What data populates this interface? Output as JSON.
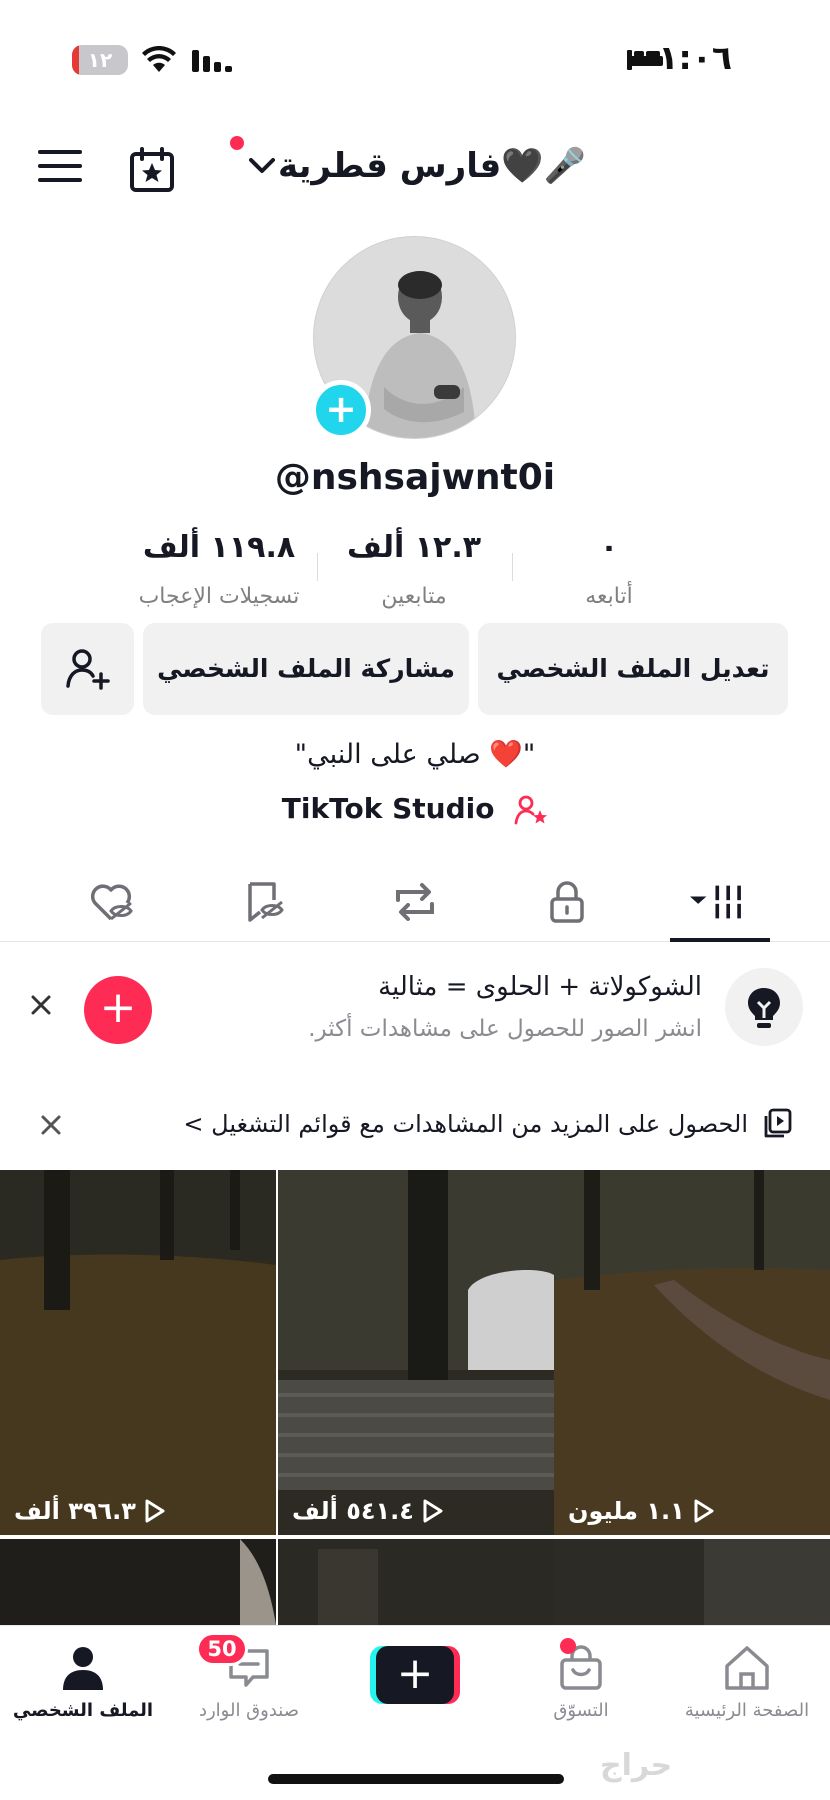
{
  "status_bar": {
    "time": "١:٠٦",
    "battery": "١٢",
    "battery_level": 0.12
  },
  "header": {
    "profile_name": "فارس قطرية🖤🎤"
  },
  "profile": {
    "username": "@nshsajwnt0i",
    "stats": [
      {
        "value": "٠",
        "label": "أتابعه"
      },
      {
        "value": "١٢.٣ ألف",
        "label": "متابعين"
      },
      {
        "value": "١١٩.٨ ألف",
        "label": "تسجيلات الإعجاب"
      }
    ],
    "buttons": {
      "edit": "تعديل الملف الشخصي",
      "share": "مشاركة الملف الشخصي"
    },
    "bio": "\"صلي على النبي ❤️\"",
    "studio_link": "TikTok Studio"
  },
  "tabs": [
    {
      "icon": "videos-grid-icon",
      "active": true
    },
    {
      "icon": "lock-icon",
      "active": false
    },
    {
      "icon": "repost-icon",
      "active": false
    },
    {
      "icon": "saved-icon",
      "active": false
    },
    {
      "icon": "liked-icon",
      "active": false
    }
  ],
  "tip": {
    "title": "الشوكولاتة + الحلوى = مثالية",
    "subtitle": "انشر الصور للحصول على مشاهدات أكثر."
  },
  "playlist_banner": {
    "text": "الحصول على المزيد من المشاهدات مع قوائم التشغيل >"
  },
  "videos": [
    {
      "views": "١.١ مليون"
    },
    {
      "views": "٥٤١.٤ ألف"
    },
    {
      "views": "٣٩٦.٣ ألف"
    }
  ],
  "bottom_nav": {
    "home": "الصفحة الرئيسية",
    "shop": "التسوّق",
    "inbox": "صندوق الوارد",
    "inbox_badge": "50",
    "profile": "الملف الشخصي"
  },
  "colors": {
    "accent": "#fe2c55",
    "cyan": "#25f4ee",
    "avatar_add": "#20d5ec",
    "dark": "#161823"
  }
}
